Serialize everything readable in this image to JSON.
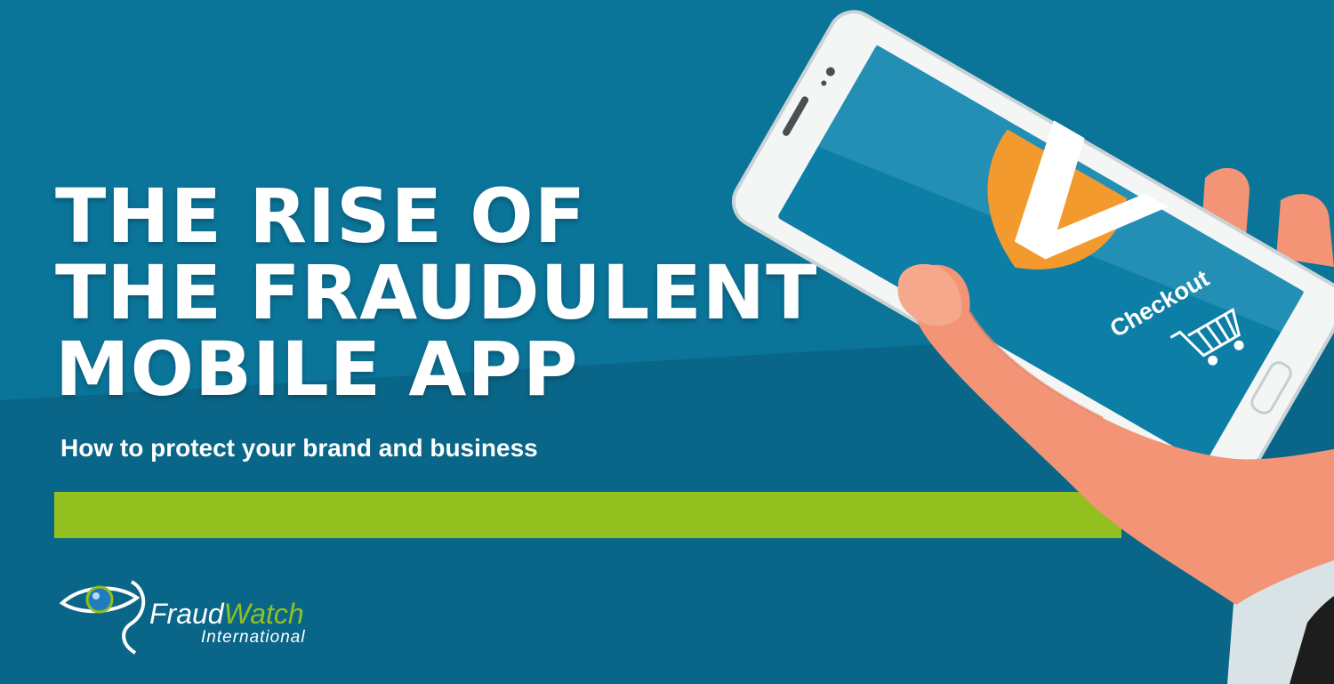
{
  "title": {
    "line1": "THE RISE OF",
    "line2": "THE FRAUDULENT",
    "line3": "MOBILE APP"
  },
  "subtitle": "How to protect your brand and business",
  "phone": {
    "checkout_label": "Checkout",
    "icons": [
      "shield-check-icon",
      "shopping-cart-icon"
    ]
  },
  "logo": {
    "name_part1": "Fraud",
    "name_part2": "Watch",
    "tagline": "International"
  },
  "colors": {
    "background": "#0b7296",
    "accent_bar": "#93c01f",
    "shield": "#f39a2e",
    "text": "#ffffff"
  }
}
